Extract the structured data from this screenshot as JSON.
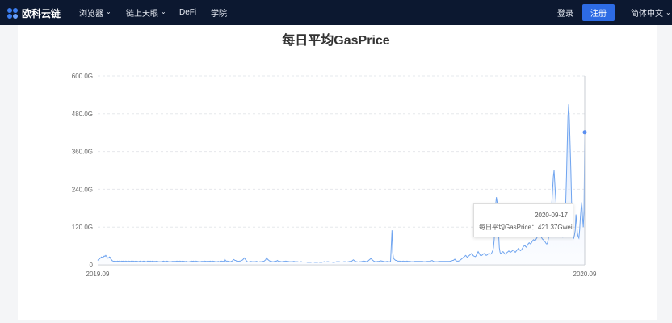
{
  "header": {
    "logo_text": "欧科云链",
    "nav": [
      {
        "label": "浏览器",
        "has_dropdown": true
      },
      {
        "label": "链上天眼",
        "has_dropdown": true
      },
      {
        "label": "DeFi",
        "has_dropdown": false
      },
      {
        "label": "学院",
        "has_dropdown": false
      }
    ],
    "login_label": "登录",
    "register_label": "注册",
    "language_label": "简体中文",
    "colors": {
      "bar_bg": "#0c1830",
      "accent": "#2d6be4"
    }
  },
  "tooltip": {
    "date": "2020-09-17",
    "series_label": "每日平均GasPrice：",
    "value_text": "421.37Gwei"
  },
  "chart_data": {
    "type": "area",
    "title": "每日平均GasPrice",
    "xlabel": "",
    "ylabel": "",
    "x_tick_labels": [
      "2019.09",
      "2020.09"
    ],
    "y_tick_labels": [
      "0",
      "120.0G",
      "240.0G",
      "360.0G",
      "480.0G",
      "600.0G"
    ],
    "ylim": [
      0,
      600
    ],
    "grid": true,
    "colors": {
      "line": "#6fa4ef",
      "area_top": "#cfe0fb",
      "area_bottom": "#f1f6ff"
    },
    "series": [
      {
        "values": [
          14,
          17,
          18,
          20,
          22,
          25,
          24,
          22,
          26,
          28,
          27,
          30,
          27,
          24,
          21,
          22,
          25,
          24,
          18,
          16,
          13,
          12,
          11,
          12,
          12,
          11,
          11,
          12,
          11,
          12,
          12,
          11,
          11,
          12,
          11,
          12,
          11,
          11,
          12,
          12,
          11,
          11,
          12,
          12,
          11,
          11,
          12,
          11,
          12,
          12,
          11,
          11,
          12,
          12,
          11,
          11,
          10,
          11,
          12,
          11,
          10,
          11,
          11,
          12,
          11,
          11,
          10,
          10,
          12,
          12,
          11,
          11,
          12,
          11,
          11,
          12,
          11,
          11,
          11,
          11,
          11,
          12,
          11,
          10,
          10,
          10,
          10,
          10,
          11,
          11,
          12,
          11,
          11,
          10,
          11,
          12,
          11,
          10,
          10,
          10,
          10,
          10,
          11,
          11,
          11,
          11,
          11,
          11,
          12,
          12,
          11,
          11,
          12,
          12,
          11,
          11,
          12,
          12,
          11,
          11,
          10,
          11,
          10,
          10,
          9,
          10,
          10,
          11,
          12,
          12,
          11,
          12,
          11,
          11,
          12,
          12,
          11,
          11,
          10,
          10,
          10,
          10,
          11,
          11,
          11,
          11,
          12,
          12,
          11,
          11,
          11,
          12,
          11,
          11,
          12,
          11,
          11,
          12,
          12,
          11,
          11,
          10,
          10,
          10,
          10,
          11,
          10,
          10,
          11,
          12,
          12,
          11,
          11,
          12,
          18,
          14,
          12,
          12,
          12,
          11,
          11,
          10,
          10,
          11,
          12,
          14,
          17,
          16,
          14,
          14,
          12,
          12,
          12,
          11,
          12,
          12,
          13,
          14,
          15,
          17,
          20,
          22,
          18,
          15,
          12,
          10,
          9,
          9,
          10,
          10,
          11,
          10,
          10,
          10,
          10,
          10,
          10,
          11,
          11,
          9,
          9,
          9,
          10,
          10,
          10,
          10,
          11,
          11,
          12,
          14,
          16,
          22,
          20,
          17,
          15,
          13,
          12,
          11,
          11,
          10,
          10,
          10,
          11,
          11,
          12,
          12,
          14,
          12,
          12,
          11,
          11,
          10,
          10,
          10,
          11,
          11,
          11,
          12,
          12,
          11,
          11,
          11,
          10,
          10,
          10,
          10,
          10,
          10,
          11,
          11,
          10,
          10,
          10,
          10,
          10,
          9,
          9,
          9,
          10,
          10,
          9,
          9,
          9,
          9,
          9,
          9,
          9,
          8,
          8,
          8,
          8,
          8,
          8,
          9,
          9,
          9,
          9,
          8,
          8,
          8,
          8,
          8,
          9,
          9,
          8,
          8,
          8,
          8,
          9,
          9,
          10,
          10,
          9,
          9,
          10,
          10,
          10,
          9,
          9,
          9,
          9,
          9,
          8,
          8,
          8,
          9,
          9,
          10,
          10,
          10,
          10,
          10,
          9,
          9,
          9,
          9,
          9,
          10,
          10,
          10,
          9,
          9,
          9,
          10,
          10,
          11,
          11,
          11,
          12,
          14,
          16,
          14,
          12,
          11,
          10,
          10,
          9,
          9,
          9,
          10,
          10,
          10,
          11,
          11,
          12,
          12,
          11,
          11,
          10,
          10,
          12,
          14,
          16,
          18,
          20,
          18,
          16,
          14,
          12,
          11,
          10,
          10,
          10,
          11,
          11,
          11,
          12,
          12,
          13,
          12,
          12,
          11,
          10,
          10,
          10,
          10,
          11,
          11,
          10,
          10,
          10,
          10,
          60,
          110,
          40,
          22,
          18,
          16,
          14,
          14,
          13,
          12,
          12,
          12,
          12,
          11,
          11,
          11,
          12,
          12,
          11,
          11,
          11,
          12,
          12,
          11,
          11,
          11,
          11,
          10,
          10,
          10,
          10,
          10,
          11,
          11,
          11,
          11,
          11,
          11,
          11,
          11,
          11,
          11,
          11,
          11,
          10,
          10,
          10,
          10,
          10,
          11,
          11,
          11,
          11,
          11,
          12,
          13,
          14,
          12,
          11,
          10,
          10,
          10,
          10,
          10,
          10,
          11,
          11,
          11,
          11,
          11,
          11,
          11,
          11,
          11,
          11,
          11,
          11,
          11,
          11,
          11,
          11,
          12,
          12,
          13,
          14,
          14,
          16,
          18,
          15,
          13,
          12,
          12,
          12,
          13,
          14,
          16,
          18,
          20,
          22,
          24,
          26,
          28,
          30,
          27,
          24,
          26,
          28,
          30,
          32,
          34,
          36,
          34,
          30,
          28,
          27,
          26,
          28,
          33,
          38,
          42,
          38,
          34,
          30,
          29,
          30,
          32,
          34,
          36,
          34,
          32,
          30,
          31,
          33,
          35,
          37,
          35,
          34,
          35,
          40,
          45,
          55,
          80,
          130,
          190,
          215,
          200,
          150,
          100,
          55,
          40,
          35,
          38,
          40,
          42,
          40,
          36,
          34,
          36,
          38,
          40,
          42,
          44,
          42,
          40,
          41,
          43,
          45,
          47,
          45,
          42,
          40,
          43,
          46,
          49,
          52,
          50,
          47,
          45,
          47,
          50,
          54,
          58,
          60,
          62,
          58,
          56,
          60,
          64,
          68,
          70,
          68,
          66,
          70,
          74,
          78,
          80,
          78,
          76,
          80,
          84,
          88,
          92,
          96,
          98,
          94,
          90,
          86,
          82,
          80,
          78,
          75,
          72,
          68,
          66,
          70,
          80,
          95,
          110,
          130,
          160,
          200,
          240,
          280,
          300,
          260,
          220,
          190,
          160,
          150,
          140,
          120,
          110,
          100,
          95,
          90,
          88,
          90,
          100,
          140,
          200,
          280,
          380,
          470,
          510,
          460,
          380,
          300,
          200,
          120,
          90,
          85,
          95,
          110,
          160,
          130,
          100,
          90,
          85,
          110,
          150,
          180,
          200,
          150,
          120,
          170,
          421
        ]
      }
    ]
  }
}
